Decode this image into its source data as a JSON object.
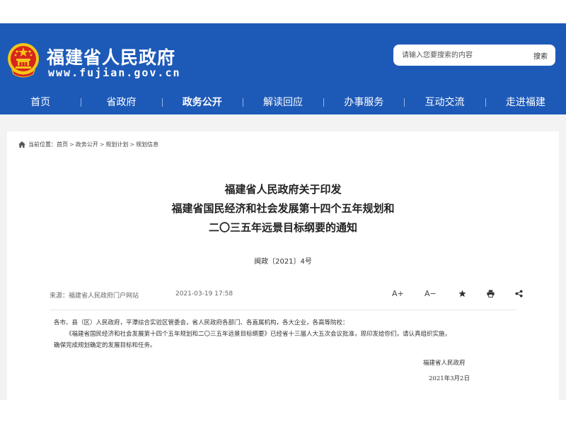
{
  "header": {
    "site_title": "福建省人民政府",
    "site_url": "www.fujian.gov.cn",
    "search": {
      "placeholder": "请输入您要搜索的内容",
      "button_label": "搜索"
    }
  },
  "nav": {
    "items": [
      {
        "label": "首页"
      },
      {
        "label": "省政府"
      },
      {
        "label": "政务公开",
        "active": true
      },
      {
        "label": "解读回应"
      },
      {
        "label": "办事服务"
      },
      {
        "label": "互动交流"
      },
      {
        "label": "走进福建"
      }
    ]
  },
  "breadcrumb": {
    "prefix": "当前位置：",
    "items": [
      "首页",
      "政务公开",
      "规划计划",
      "规划信息"
    ],
    "separator": ">"
  },
  "article": {
    "title_lines": [
      "福建省人民政府关于印发",
      "福建省国民经济和社会发展第十四个五年规划和",
      "二〇三五年远景目标纲要的通知"
    ],
    "doc_number": "闽政〔2021〕4号",
    "source": "来源：福建省人民政府门户网站",
    "date": "2021-03-19 17:58",
    "tools": {
      "font_increase": "A+",
      "font_decrease": "A−"
    },
    "salutation": "各市、县（区）人民政府，平潭综合实验区管委会，省人民政府各部门、各直属机构，各大企业，各高等院校：",
    "paragraph_1": "《福建省国民经济和社会发展第十四个五年规划和二〇三五年远景目标纲要》已经省十三届人大五次会议批准，现印发给你们，请认真组织实施，",
    "paragraph_2": "确保完成规划确定的发展目标和任务。",
    "signature_org": "福建省人民政府",
    "signature_date": "2021年3月2日"
  },
  "colors": {
    "header_blue": "#1d5ab8",
    "emblem_red": "#d7261e",
    "emblem_gold": "#f5c518"
  }
}
